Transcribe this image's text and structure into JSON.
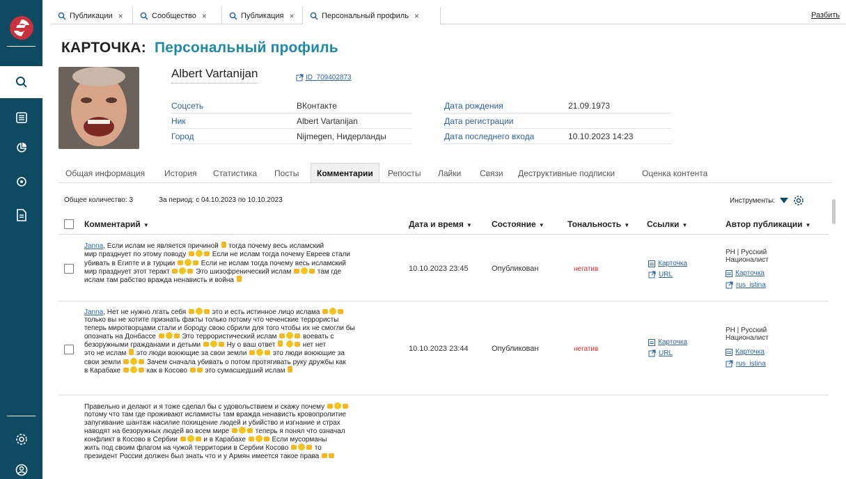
{
  "tabs": [
    {
      "label": "Публикации"
    },
    {
      "label": "Сообщество"
    },
    {
      "label": "Публикация"
    },
    {
      "label": "Персональный профиль"
    }
  ],
  "tab_close": "×",
  "split_label": "Разбить",
  "header": {
    "title_prefix": "КАРТОЧКА:",
    "title": "Персональный профиль"
  },
  "profile": {
    "name": "Albert Vartanijan",
    "id": "ID_709402873",
    "fields_left": [
      {
        "label": "Соцсеть",
        "value": "ВКонтакте"
      },
      {
        "label": "Ник",
        "value": "Albert Vartanijan"
      },
      {
        "label": "Город",
        "value": "Nijmegen, Нидерланды"
      }
    ],
    "fields_right": [
      {
        "label": "Дата рождения",
        "value": "21.09.1973"
      },
      {
        "label": "Дата регистрации",
        "value": ""
      },
      {
        "label": "Дата последнего входа",
        "value": "10.10.2023 14:23"
      }
    ]
  },
  "section_tabs": [
    "Общая информация",
    "История",
    "Статистика",
    "Посты",
    "Комментарии",
    "Репосты",
    "Лайки",
    "Связи",
    "Деструктивные подписки",
    "Оценка контента"
  ],
  "summary": {
    "total": "Общее количество: 3",
    "period": "За период: с 04.10.2023 по 10.10.2023",
    "tools": "Инструменты:"
  },
  "columns": {
    "comment": "Комментарий",
    "datetime": "Дата и время",
    "state": "Состояние",
    "tone": "Тональность",
    "links": "Ссылки",
    "author": "Автор публикации"
  },
  "rows": [
    {
      "author_link": "Janna",
      "lines": [
        ", Если ислам не является причиной :h: тогда почему весь исламский",
        "мир празднует по этому поводу :p::e::p: Если не ислам тогда почему Евреев стали",
        "убивать в Египте и в турции :p::e::p: Если не ислам тогда почему весь исламский",
        "мир празднует этот теракт :p::e::p: Это шизофренический ислам :p::e::p: там где",
        "ислам там рабство вражда ненависть и война :h:"
      ],
      "datetime": "10.10.2023 23:45",
      "state": "Опубликован",
      "tone": "негатив",
      "link_card": "Карточка",
      "link_url": "URL",
      "author_name": "РН | Русский Националист",
      "author_card": "Карточка",
      "author_link2": "rus_istina"
    },
    {
      "author_link": "Janna",
      "lines": [
        ", Нет не нужно лгать себя :p::e::p: это и есть истинное лицо ислама :p::e::p:",
        "только вы не хотите признать факты только потому что чеченские террористы",
        "теперь миротворцами стали и бороду свою сбрили для того чтобы их не смогли бы",
        "опознать на Донбассе :p::e::p: Это террористический ислам :p::e::p: воевать с",
        "безоружными гражданами и детьми :p::e::p: Ну о ваш ответ :h: :e::p: нет нет",
        "это не ислам :h: это люди воюющие за свои земли :p::e::p: это люди воюющие за",
        "свои земли :p::e::p: Зачем сначала убивать о потом протягивать руку дружбы как",
        "в Карабахе :p::e::p: как в Косово :p::p: это сумасшедший ислам :h:"
      ],
      "datetime": "10.10.2023 23:44",
      "state": "Опубликован",
      "tone": "негатив",
      "link_card": "Карточка",
      "link_url": "URL",
      "author_name": "РН | Русский Националист",
      "author_card": "Карточка",
      "author_link2": "rus_istina"
    },
    {
      "author_link": "",
      "lines": [
        "Правельно и делают и я тоже сделал бы с удовольствием и скажу почему :p::e::p:",
        "потому что там где проживают исламисты там вражда ненависть кровопролитие",
        "запугивание шантаж насилие похищение людей и убийство и изгнание и страх",
        "наводят на безоружных людей во всем мире :p::e::p: теперь я понял что означал",
        "конфликт в Косово в Сербии :p::e::p: и в Карабахе :p::e::p: Если мусорманы",
        "жить под своим флагом на чужой территории в Сербии Косово :p::e::p: то",
        "президент России должен был знать что и у Армян имеется такое права :p::p:"
      ]
    }
  ]
}
